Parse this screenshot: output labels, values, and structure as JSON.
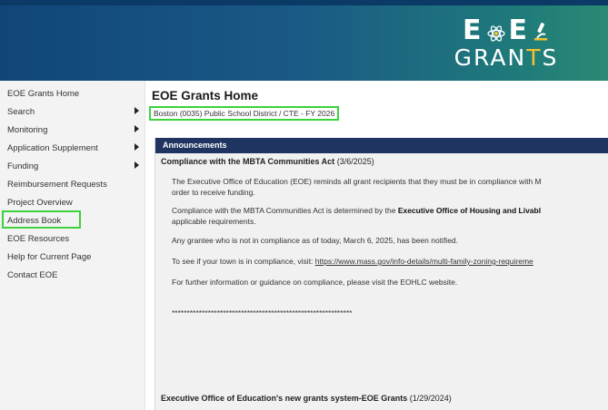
{
  "header": {
    "logo_top_left": "E",
    "logo_top_right": "E",
    "logo_bottom_a": "GRAN",
    "logo_bottom_b": "T",
    "logo_bottom_c": "S",
    "colors": {
      "banner_start": "#11457a",
      "banner_end": "#2a8a73",
      "accent": "#f2c230"
    }
  },
  "sidebar": {
    "items": [
      {
        "label": "EOE Grants Home",
        "submenu": false
      },
      {
        "label": "Search",
        "submenu": true
      },
      {
        "label": "Monitoring",
        "submenu": true
      },
      {
        "label": "Application Supplement",
        "submenu": true
      },
      {
        "label": "Funding",
        "submenu": true
      },
      {
        "label": "Reimbursement Requests",
        "submenu": false
      },
      {
        "label": "Project Overview",
        "submenu": false
      },
      {
        "label": "Address Book",
        "submenu": false,
        "highlighted": true
      },
      {
        "label": "EOE Resources",
        "submenu": false
      },
      {
        "label": "Help for Current Page",
        "submenu": false
      },
      {
        "label": "Contact EOE",
        "submenu": false
      }
    ]
  },
  "main": {
    "title": "EOE Grants Home",
    "breadcrumb": "Boston (0035) Public School District / CTE - FY 2026",
    "panel_header": "Announcements",
    "announcement1": {
      "title": "Compliance with the MBTA Communities Act",
      "date": "(3/6/2025)",
      "p1_line1": "The Executive Office of Education (EOE) reminds all grant recipients that they must be in compliance with M",
      "p1_line2": "order to receive funding.",
      "p2_line1_a": "Compliance with the MBTA Communities Act is determined by the ",
      "p2_line1_b": "Executive Office of Housing and Livabl",
      "p2_line2": "applicable requirements.",
      "p3": "Any grantee who is not in compliance as of today, March 6, 2025, has been notified.",
      "p4_a": "To see if your town is in compliance, visit: ",
      "p4_link": "https://www.mass.gov/info-details/multi-family-zoning-requireme",
      "p5": "For further information or guidance on compliance, please visit the EOHLC website.",
      "divider": "************************************************************"
    },
    "announcement2": {
      "title": "Executive Office of Education's new grants system-EOE Grants",
      "date": "(1/29/2024)"
    }
  }
}
